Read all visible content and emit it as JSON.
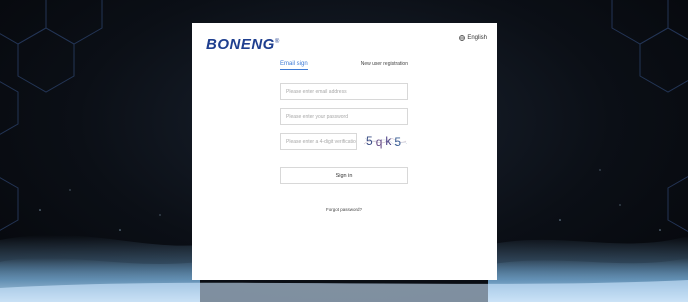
{
  "brand": {
    "logo": "BONENG",
    "trademark": "®"
  },
  "language": {
    "label": "English",
    "icon": "globe-icon"
  },
  "tabs": {
    "email_sign": "Email sign",
    "registration": "New user registration"
  },
  "form": {
    "email_placeholder": "Please enter email address",
    "password_placeholder": "Please enter your password",
    "captcha_placeholder": "Please enter a 4-digit verification",
    "captcha_code": "5qk5",
    "signin_label": "Sign in",
    "forgot_label": "Forgot password?"
  },
  "colors": {
    "brand": "#1f3f8f",
    "accent": "#3d7ad6",
    "background": "#0b0f16"
  }
}
